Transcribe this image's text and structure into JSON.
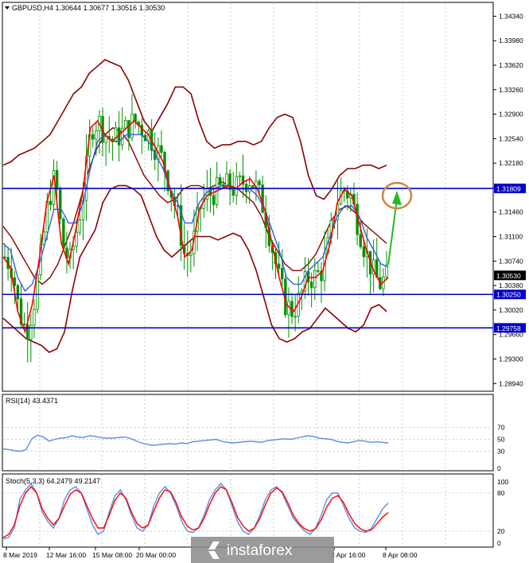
{
  "chart_data": {
    "type": "line",
    "title": "GBPUSD,H4",
    "ohlc": {
      "open": "1.30644",
      "high": "1.30677",
      "low": "1.30516",
      "close": "1.30530"
    },
    "price_axis_ticks": [
      "1.34340",
      "1.33980",
      "1.33620",
      "1.33260",
      "1.32900",
      "1.32540",
      "1.32180",
      "1.31820",
      "1.31460",
      "1.31100",
      "1.30740",
      "1.30380",
      "1.30020",
      "1.29660",
      "1.29300",
      "1.28940"
    ],
    "ylim": [
      1.2885,
      1.3452
    ],
    "price_labels": [
      {
        "text": "1.31809",
        "value": 1.31809,
        "color": "#0000cc"
      },
      {
        "text": "1.30530",
        "value": 1.3053,
        "color": "#000000"
      },
      {
        "text": "1.30250",
        "value": 1.3025,
        "color": "#0000cc"
      },
      {
        "text": "1.29758",
        "value": 1.29758,
        "color": "#0000cc"
      }
    ],
    "horizontal_levels": [
      1.31809,
      1.3025,
      1.29758
    ],
    "x_tick_labels": [
      "8 Mar 2019",
      "12 Mar 16:00",
      "15 Mar 08:00",
      "20 Mar 00:00",
      "3 Apr 16:00",
      "8 Apr 08:00"
    ],
    "series": [
      {
        "values": [
          1.308,
          1.3065,
          1.3,
          1.297,
          1.301,
          1.308,
          1.316,
          1.32,
          1.31,
          1.307,
          1.312,
          1.318,
          1.327,
          1.328,
          1.326,
          1.325,
          1.326,
          1.327,
          1.328,
          1.327,
          1.326,
          1.324,
          1.322,
          1.318,
          1.314,
          1.308,
          1.309,
          1.315,
          1.317,
          1.3175,
          1.318,
          1.3185,
          1.318,
          1.319,
          1.3195,
          1.318,
          1.315,
          1.31,
          1.305,
          1.301,
          1.3,
          1.302,
          1.305,
          1.305,
          1.306,
          1.31,
          1.316,
          1.318,
          1.317,
          1.313,
          1.309,
          1.306,
          1.304,
          1.305
        ]
      },
      {
        "values": [
          1.31,
          1.309,
          1.305,
          1.303,
          1.304,
          1.307,
          1.311,
          1.315,
          1.315,
          1.313,
          1.313,
          1.316,
          1.321,
          1.325,
          1.326,
          1.325,
          1.325,
          1.326,
          1.326,
          1.326,
          1.325,
          1.323,
          1.321,
          1.318,
          1.316,
          1.313,
          1.313,
          1.316,
          1.3175,
          1.318,
          1.3185,
          1.3185,
          1.318,
          1.318,
          1.318,
          1.317,
          1.315,
          1.312,
          1.309,
          1.305,
          1.304,
          1.304,
          1.306,
          1.307,
          1.308,
          1.311,
          1.314,
          1.3155,
          1.3155,
          1.314,
          1.311,
          1.309,
          1.307,
          1.3065
        ]
      },
      {
        "values": [
          1.3215,
          1.322,
          1.323,
          1.3235,
          1.324,
          1.325,
          1.326,
          1.328,
          1.33,
          1.332,
          1.333,
          1.335,
          1.336,
          1.337,
          1.3365,
          1.336,
          1.334,
          1.331,
          1.328,
          1.3265,
          1.3285,
          1.3305,
          1.333,
          1.333,
          1.332,
          1.328,
          1.325,
          1.324,
          1.3245,
          1.3245,
          1.325,
          1.325,
          1.3245,
          1.325,
          1.327,
          1.3285,
          1.329,
          1.3285,
          1.325,
          1.32,
          1.317,
          1.3165,
          1.318,
          1.32,
          1.321,
          1.321,
          1.3215,
          1.3215,
          1.321,
          1.3215
        ]
      },
      {
        "values": [
          1.299,
          1.298,
          1.297,
          1.296,
          1.2955,
          1.295,
          1.294,
          1.2945,
          1.297,
          1.303,
          1.308,
          1.31,
          1.312,
          1.316,
          1.318,
          1.3185,
          1.3185,
          1.318,
          1.317,
          1.314,
          1.311,
          1.309,
          1.308,
          1.309,
          1.31,
          1.311,
          1.311,
          1.311,
          1.3105,
          1.311,
          1.3115,
          1.311,
          1.309,
          1.306,
          1.302,
          1.298,
          1.296,
          1.2955,
          1.296,
          1.297,
          1.2975,
          1.299,
          1.3005,
          1.2995,
          1.2985,
          1.2975,
          1.297,
          1.298,
          1.3005,
          1.301,
          1.3
        ]
      },
      {
        "values": [
          1.3125,
          1.311,
          1.309,
          1.307,
          1.305,
          1.304,
          1.305,
          1.307,
          1.31,
          1.313,
          1.317,
          1.321,
          1.324,
          1.326,
          1.327,
          1.3265,
          1.325,
          1.3225,
          1.32,
          1.3185,
          1.317,
          1.316,
          1.3165,
          1.318,
          1.3185,
          1.3185,
          1.318,
          1.3185,
          1.319,
          1.3185,
          1.318,
          1.317,
          1.316,
          1.314,
          1.311,
          1.309,
          1.307,
          1.306,
          1.306,
          1.307,
          1.3085,
          1.311,
          1.3135,
          1.315,
          1.3155,
          1.3145,
          1.313,
          1.312,
          1.311,
          1.31
        ]
      }
    ],
    "indicators": [
      {
        "name": "RSI(14) 43.4371",
        "levels": [
          "70",
          "50",
          "30",
          "0"
        ],
        "ylim": [
          0,
          100
        ],
        "series": [
          {
            "values": [
              34,
              33,
              31,
              30,
              33,
              51,
              57,
              54,
              47,
              50,
              52,
              53,
              56,
              54,
              53,
              56,
              55,
              53,
              52,
              52,
              53,
              54,
              52,
              48,
              44,
              42,
              40,
              41,
              42,
              43,
              42,
              44,
              43,
              46,
              47,
              48,
              49,
              50,
              47,
              45,
              44,
              45,
              46,
              47,
              46,
              45,
              48,
              49,
              50,
              51,
              50,
              52,
              54,
              56,
              55,
              52,
              51,
              50,
              47,
              45,
              44,
              46,
              48,
              47,
              45,
              46,
              45,
              44
            ]
          }
        ]
      },
      {
        "name": "Stoch(5,3,3) 64.2479 49.2147",
        "levels": [
          "100",
          "80",
          "20",
          "0"
        ],
        "ylim": [
          0,
          100
        ],
        "series": [
          {
            "values": [
              8,
              10,
              25,
              70,
              85,
              95,
              80,
              50,
              35,
              25,
              40,
              70,
              85,
              90,
              80,
              55,
              30,
              15,
              20,
              50,
              75,
              85,
              70,
              45,
              25,
              20,
              30,
              60,
              80,
              90,
              80,
              60,
              35,
              20,
              18,
              25,
              45,
              70,
              85,
              95,
              85,
              60,
              35,
              20,
              15,
              25,
              45,
              70,
              85,
              90,
              80,
              60,
              40,
              30,
              20,
              15,
              25,
              45,
              70,
              80,
              80,
              60,
              40,
              25,
              20,
              18,
              25,
              40,
              55,
              64.2479
            ]
          },
          {
            "values": [
              10,
              15,
              30,
              60,
              80,
              90,
              80,
              55,
              40,
              30,
              40,
              60,
              78,
              85,
              80,
              60,
              40,
              25,
              25,
              45,
              68,
              80,
              72,
              50,
              32,
              25,
              30,
              52,
              72,
              85,
              82,
              65,
              42,
              28,
              22,
              25,
              40,
              62,
              80,
              90,
              85,
              65,
              42,
              28,
              20,
              25,
              40,
              62,
              80,
              88,
              82,
              65,
              45,
              32,
              24,
              20,
              24,
              38,
              58,
              72,
              76,
              65,
              47,
              32,
              24,
              20,
              22,
              32,
              42,
              49.2147
            ]
          }
        ]
      }
    ],
    "annotations": [
      "green-up-arrow",
      "orange-target-circle"
    ]
  },
  "watermark": {
    "text": "instaforex"
  },
  "colors": {
    "bollinger": "#8b0000",
    "ma_fast": "#ff0000",
    "ma_slow": "#3060e0",
    "level_line": "#0000cc",
    "candle": "#009000",
    "rsi_line": "#5b8fe0",
    "stoch_main": "#5b8fe0",
    "stoch_signal": "#ff0000",
    "arrow": "#22bb22",
    "circle": "#cd853f"
  }
}
